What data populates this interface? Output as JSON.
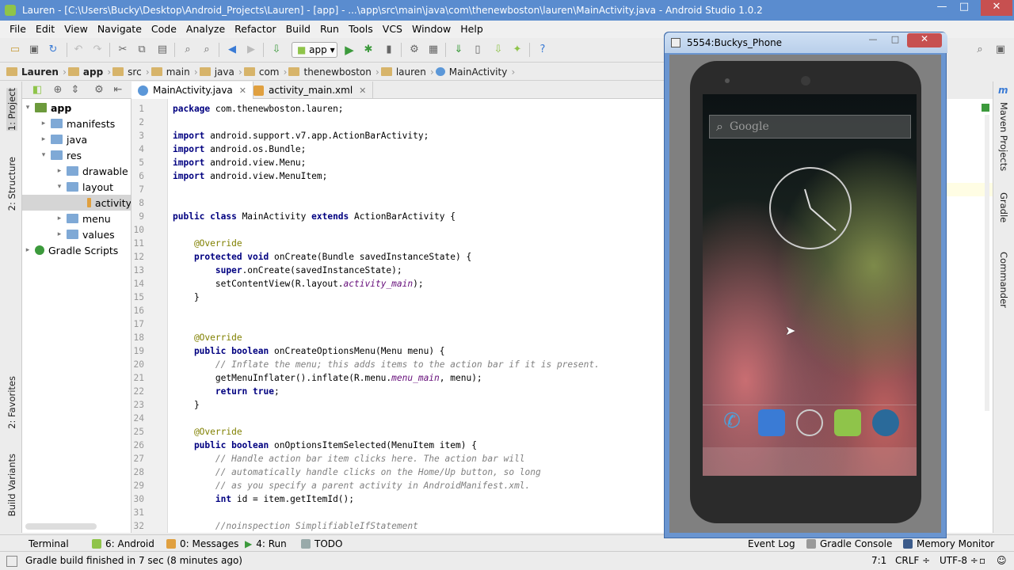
{
  "window": {
    "title": "Lauren - [C:\\Users\\Bucky\\Desktop\\Android_Projects\\Lauren] - [app] - ...\\app\\src\\main\\java\\com\\thenewboston\\lauren\\MainActivity.java - Android Studio 1.0.2",
    "minimize": "—",
    "maximize": "□",
    "close": "✕"
  },
  "menu": [
    "File",
    "Edit",
    "View",
    "Navigate",
    "Code",
    "Analyze",
    "Refactor",
    "Build",
    "Run",
    "Tools",
    "VCS",
    "Window",
    "Help"
  ],
  "toolbar": {
    "run_config": "app",
    "dropdown": "▾"
  },
  "breadcrumb": [
    "Lauren",
    "app",
    "src",
    "main",
    "java",
    "com",
    "thenewboston",
    "lauren",
    "MainActivity"
  ],
  "left_tools": {
    "project": "1: Project",
    "structure": "2: Structure",
    "favorites": "2: Favorites",
    "build_variants": "Build Variants"
  },
  "right_tools": {
    "maven": "Maven Projects",
    "gradle": "Gradle",
    "commander": "Commander",
    "m": "m"
  },
  "tree": [
    {
      "label": "app",
      "depth": 0,
      "arrow": "▾"
    },
    {
      "label": "manifests",
      "depth": 1,
      "arrow": "▸"
    },
    {
      "label": "java",
      "depth": 1,
      "arrow": "▸"
    },
    {
      "label": "res",
      "depth": 1,
      "arrow": "▾"
    },
    {
      "label": "drawable",
      "depth": 2,
      "arrow": "▸"
    },
    {
      "label": "layout",
      "depth": 2,
      "arrow": "▾"
    },
    {
      "label": "activity",
      "depth": 3,
      "arrow": ""
    },
    {
      "label": "menu",
      "depth": 2,
      "arrow": "▸"
    },
    {
      "label": "values",
      "depth": 2,
      "arrow": "▸"
    },
    {
      "label": "Gradle Scripts",
      "depth": 0,
      "arrow": "▸"
    }
  ],
  "tabs": [
    {
      "label": "MainActivity.java",
      "close": "✕"
    },
    {
      "label": "activity_main.xml",
      "close": "✕"
    }
  ],
  "code_lines": [
    [
      [
        "kw",
        "package"
      ],
      [
        "",
        "com.thenewboston.lauren;"
      ]
    ],
    [],
    [
      [
        "kw",
        "import"
      ],
      [
        "",
        "android.support.v7.app.ActionBarActivity;"
      ]
    ],
    [
      [
        "kw",
        "import"
      ],
      [
        "",
        "android.os.Bundle;"
      ]
    ],
    [
      [
        "kw",
        "import"
      ],
      [
        "",
        "android.view.Menu;"
      ]
    ],
    [
      [
        "kw",
        "import"
      ],
      [
        "",
        "android.view.MenuItem;"
      ]
    ],
    [],
    [],
    [
      [
        "kw",
        "public class"
      ],
      [
        "",
        "MainActivity"
      ],
      [
        "kw",
        "extends"
      ],
      [
        "",
        "ActionBarActivity {"
      ]
    ],
    [],
    [
      [
        "an",
        "    @Override"
      ]
    ],
    [
      [
        "kw",
        "    protected void"
      ],
      [
        "",
        "onCreate(Bundle savedInstanceState) {"
      ]
    ],
    [
      [
        "kw",
        "        super"
      ],
      [
        "",
        ".onCreate(savedInstanceState);"
      ]
    ],
    [
      [
        "",
        "        setContentView(R.layout."
      ],
      [
        "fd",
        "activity_main"
      ],
      [
        "",
        ");"
      ]
    ],
    [
      [
        "",
        "    }"
      ]
    ],
    [],
    [],
    [
      [
        "an",
        "    @Override"
      ]
    ],
    [
      [
        "kw",
        "    public boolean"
      ],
      [
        "",
        "onCreateOptionsMenu(Menu menu) {"
      ]
    ],
    [
      [
        "cm",
        "        // Inflate the menu; this adds items to the action bar if it is present."
      ]
    ],
    [
      [
        "",
        "        getMenuInflater().inflate(R.menu."
      ],
      [
        "fd",
        "menu_main"
      ],
      [
        "",
        ", menu);"
      ]
    ],
    [
      [
        "kw",
        "        return true"
      ],
      [
        "",
        ";"
      ]
    ],
    [
      [
        "",
        "    }"
      ]
    ],
    [],
    [
      [
        "an",
        "    @Override"
      ]
    ],
    [
      [
        "kw",
        "    public boolean"
      ],
      [
        "",
        "onOptionsItemSelected(MenuItem item) {"
      ]
    ],
    [
      [
        "cm",
        "        // Handle action bar item clicks here. The action bar will"
      ]
    ],
    [
      [
        "cm",
        "        // automatically handle clicks on the Home/Up button, so long"
      ]
    ],
    [
      [
        "cm",
        "        // as you specify a parent activity in AndroidManifest.xml."
      ]
    ],
    [
      [
        "kw",
        "        int"
      ],
      [
        "",
        "id = item.getItemId();"
      ]
    ],
    [],
    [
      [
        "cm",
        "        //noinspection SimplifiableIfStatement"
      ]
    ]
  ],
  "bottom_tools": {
    "terminal": "Terminal",
    "android": "6: Android",
    "messages": "0: Messages",
    "run": "4: Run",
    "todo": "TODO",
    "event_log": "Event Log",
    "gradle_console": "Gradle Console",
    "memory_monitor": "Memory Monitor"
  },
  "status": {
    "message": "Gradle build finished in 7 sec (8 minutes ago)",
    "position": "7:1",
    "line_sep": "CRLF ÷",
    "encoding": "UTF-8 ÷"
  },
  "emulator": {
    "title": "5554:Buckys_Phone",
    "search_placeholder": "Google",
    "min": "—",
    "max": "□",
    "close": "✕"
  },
  "colors": {
    "title_blue": "#5a8ccf",
    "keyword": "#000080",
    "annotation": "#808000",
    "comment": "#808080",
    "field": "#660e7a",
    "run_green": "#3c9a3c"
  }
}
